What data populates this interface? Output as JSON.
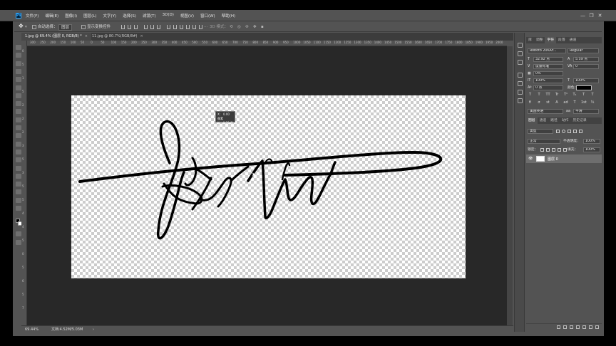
{
  "app": {
    "logo": "Ps"
  },
  "menu": [
    "文件(F)",
    "编辑(E)",
    "图像(I)",
    "图层(L)",
    "文字(Y)",
    "选择(S)",
    "滤镜(T)",
    "3D(D)",
    "视图(V)",
    "窗口(W)",
    "帮助(H)"
  ],
  "window_controls": {
    "minimize": "—",
    "restore": "❐",
    "close": "✕"
  },
  "options": {
    "auto_select_label": "自动选择：",
    "auto_select_value": "图层",
    "show_transform_label": "显示变换控件",
    "mode_3d_label": "3D 模式：",
    "more": "···"
  },
  "tabs": [
    {
      "label": "1.jpg @ 69.4% (图层 0, RGB/8) *",
      "close": "×",
      "active": true
    },
    {
      "label": "11.jpg @ 80.7%(RGB/8#)",
      "close": "×",
      "active": false
    }
  ],
  "ruler_top": [
    "300",
    "250",
    "200",
    "150",
    "100",
    "50",
    "0",
    "50",
    "100",
    "150",
    "200",
    "250",
    "300",
    "350",
    "400",
    "450",
    "500",
    "550",
    "600",
    "650",
    "700",
    "750",
    "800",
    "850",
    "900",
    "950",
    "1000",
    "1050",
    "1100",
    "1150",
    "1200",
    "1250",
    "1300",
    "1350",
    "1400",
    "1450",
    "1500",
    "1550",
    "1600",
    "1650",
    "1700",
    "1750",
    "1800",
    "1850",
    "1900",
    "1950",
    "2000"
  ],
  "ruler_left": [
    "0",
    "5",
    "1",
    "5",
    "2",
    "2",
    "2",
    "3",
    "5",
    "3",
    "5",
    "5",
    "4",
    "4",
    "5",
    "0",
    "5",
    "6",
    "5",
    "7"
  ],
  "tooltip": {
    "line1": "X：  0.00 像素",
    "line2": "Y：  0.00 像素"
  },
  "status": {
    "zoom": "69.44%",
    "doc": "文档:4.52M/5.03M",
    "arrow": "›"
  },
  "character_panel": {
    "tabs": [
      "库",
      "调整",
      "字符",
      "段落",
      "通道"
    ],
    "active_tab": "字符",
    "font_family": "Roboto 20KAF...",
    "font_style": "Regular",
    "font_size": "32.92 点",
    "leading": "5.59 点",
    "kerning": "度量标准",
    "tracking": "0",
    "tsume": "0%",
    "vscale": "100%",
    "hscale": "100%",
    "baseline": "0 点",
    "color_label": "颜色：",
    "color": "#000000",
    "style_buttons": [
      "T",
      "T",
      "TT",
      "Tr",
      "T¹",
      "T₁",
      "T",
      "T"
    ],
    "ot_buttons": [
      "fi",
      "σ",
      "st",
      "A",
      "ad",
      "T",
      "1st",
      "½"
    ],
    "language": "美国英语",
    "aa_label": "aa",
    "aa": "平滑"
  },
  "layers_panel": {
    "tabs": [
      "图层",
      "通道",
      "路径",
      "动作",
      "历史记录"
    ],
    "active_tab": "图层",
    "filter_kind": "类型",
    "blend_mode": "正常",
    "opacity_label": "不透明度：",
    "opacity": "100%",
    "lock_label": "锁定：",
    "fill_label": "填充：",
    "fill": "100%",
    "layers": [
      {
        "name": "图层 0",
        "visible": true
      }
    ],
    "footer_icons": [
      "link-icon",
      "fx-icon",
      "mask-icon",
      "adjustment-icon",
      "group-icon",
      "new-layer-icon",
      "trash-icon"
    ]
  }
}
